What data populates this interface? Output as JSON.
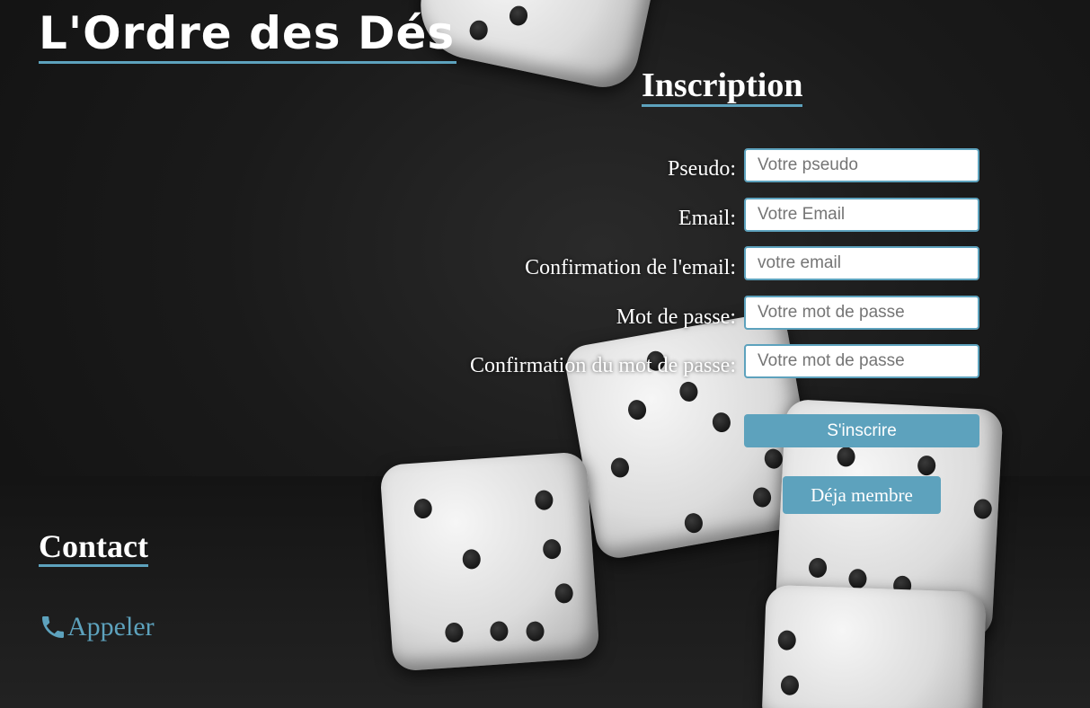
{
  "header": {
    "title": "L'Ordre des Dés"
  },
  "inscription": {
    "title": "Inscription",
    "fields": [
      {
        "label": "Pseudo:",
        "placeholder": "Votre pseudo"
      },
      {
        "label": "Email:",
        "placeholder": "Votre Email"
      },
      {
        "label": "Confirmation de l'email:",
        "placeholder": "votre email"
      },
      {
        "label": "Mot de passe:",
        "placeholder": "Votre mot de passe"
      },
      {
        "label": "Confirmation du mot de passe:",
        "placeholder": "Votre mot de passe"
      }
    ],
    "submit_label": "S'inscrire",
    "member_label": "Déja membre"
  },
  "contact": {
    "title": "Contact",
    "call_label": "Appeler",
    "call_icon": "phone-icon"
  },
  "colors": {
    "accent": "#5da2bd",
    "background": "#1a1a1a",
    "text": "#ffffff"
  }
}
